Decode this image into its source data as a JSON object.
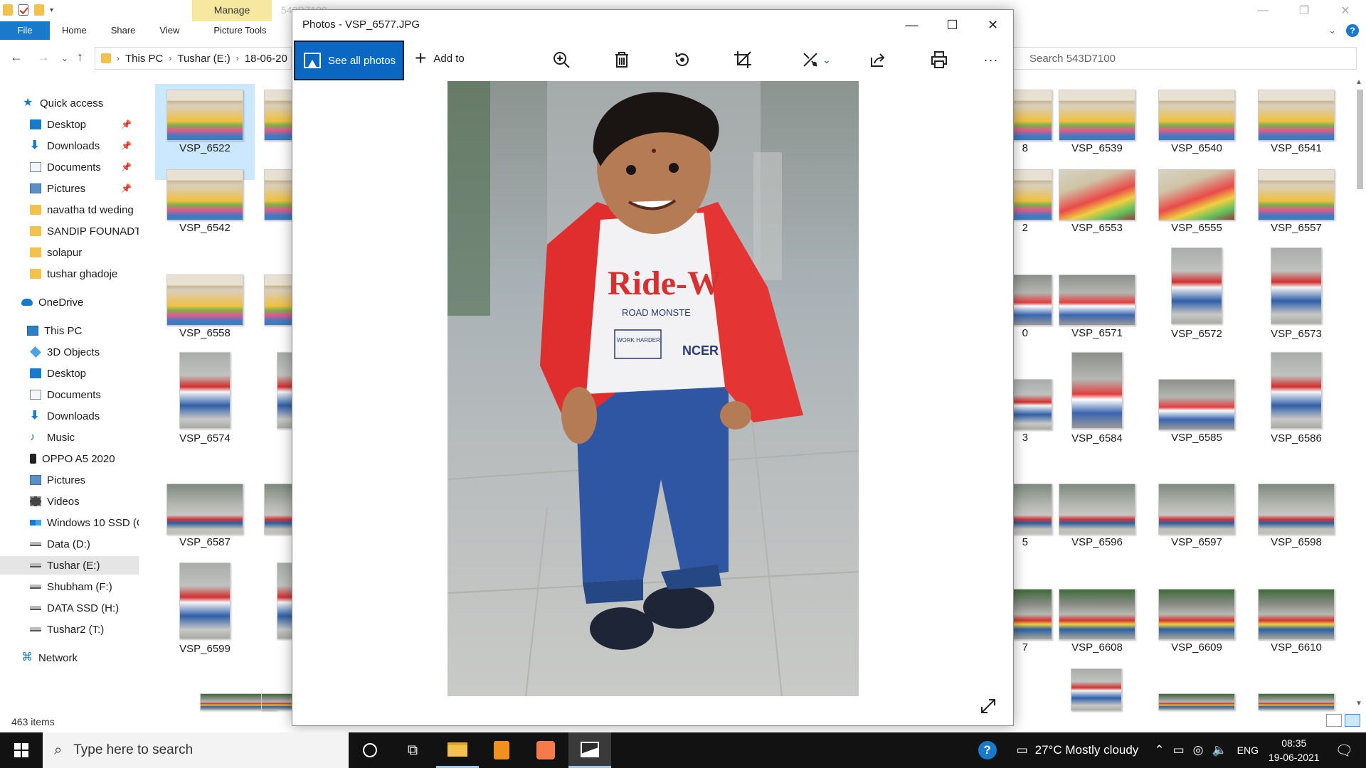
{
  "explorer": {
    "ghost_title": "543D7100",
    "manage_label": "Manage",
    "ribbon_tabs": [
      "File",
      "Home",
      "Share",
      "View",
      "Picture Tools"
    ],
    "breadcrumb": [
      "This PC",
      "Tushar (E:)",
      "18-06-20"
    ],
    "search_placeholder": "Search 543D7100",
    "status_items": "463 items",
    "nav": [
      {
        "label": "Quick access",
        "icon": "star-icon"
      },
      {
        "label": "Desktop",
        "icon": "desktop-icon",
        "pinned": true
      },
      {
        "label": "Downloads",
        "icon": "download-icon",
        "pinned": true
      },
      {
        "label": "Documents",
        "icon": "documents-icon",
        "pinned": true
      },
      {
        "label": "Pictures",
        "icon": "pictures-icon",
        "pinned": true
      },
      {
        "label": "navatha td weding",
        "icon": "folder-icon"
      },
      {
        "label": "SANDIP FOUNADTI",
        "icon": "folder-icon"
      },
      {
        "label": "solapur",
        "icon": "folder-icon"
      },
      {
        "label": "tushar ghadoje",
        "icon": "folder-icon"
      },
      {
        "label": "OneDrive",
        "icon": "onedrive-icon"
      },
      {
        "label": "This PC",
        "icon": "this-pc-icon"
      },
      {
        "label": "3D Objects",
        "icon": "3d-objects-icon"
      },
      {
        "label": "Desktop",
        "icon": "desktop-icon"
      },
      {
        "label": "Documents",
        "icon": "documents-icon"
      },
      {
        "label": "Downloads",
        "icon": "download-icon"
      },
      {
        "label": "Music",
        "icon": "music-icon"
      },
      {
        "label": "OPPO A5 2020",
        "icon": "phone-icon"
      },
      {
        "label": "Pictures",
        "icon": "pictures-icon"
      },
      {
        "label": "Videos",
        "icon": "videos-icon"
      },
      {
        "label": "Windows 10 SSD (C",
        "icon": "windows-drive-icon"
      },
      {
        "label": "Data (D:)",
        "icon": "drive-icon"
      },
      {
        "label": "Tushar (E:)",
        "icon": "drive-icon",
        "selected": true
      },
      {
        "label": "Shubham (F:)",
        "icon": "drive-icon"
      },
      {
        "label": "DATA SSD (H:)",
        "icon": "drive-icon"
      },
      {
        "label": "Tushar2 (T:)",
        "icon": "drive-icon"
      },
      {
        "label": "Network",
        "icon": "network-icon"
      }
    ],
    "left_files": [
      "VSP_6522",
      "VSP_6542",
      "VSP_6558",
      "VSP_6574",
      "VSP_6587",
      "VSP_6599"
    ],
    "left_files_col2": [
      "VS",
      "VS",
      "VS",
      "VS",
      "VS",
      "VS"
    ],
    "right_partial": [
      "8",
      "2",
      "0",
      "3",
      "5",
      "7"
    ],
    "right_files": [
      [
        "VSP_6539",
        "VSP_6540",
        "VSP_6541"
      ],
      [
        "VSP_6553",
        "VSP_6555",
        "VSP_6557"
      ],
      [
        "VSP_6571",
        "VSP_6572",
        "VSP_6573"
      ],
      [
        "VSP_6584",
        "VSP_6585",
        "VSP_6586"
      ],
      [
        "VSP_6596",
        "VSP_6597",
        "VSP_6598"
      ],
      [
        "VSP_6608",
        "VSP_6609",
        "VSP_6610"
      ]
    ]
  },
  "photos": {
    "title": "Photos - VSP_6577.JPG",
    "see_all": "See all photos",
    "add_to": "Add to",
    "shirt_text": "Ride-W",
    "shirt_sub": "ROAD MONSTE",
    "shirt_badge": "WORK HARDER",
    "shirt_side": "NCER",
    "toolbar_icons": [
      "zoom-in-icon",
      "delete-icon",
      "rotate-icon",
      "crop-icon",
      "edit-icon",
      "share-icon",
      "print-icon",
      "more-icon"
    ]
  },
  "taskbar": {
    "search_placeholder": "Type here to search",
    "weather": "27°C  Mostly cloudy",
    "language": "ENG",
    "time": "08:35",
    "date": "19-06-2021"
  },
  "colors": {
    "accent": "#1979ca",
    "photos_accent": "#0a68c3",
    "selection": "#cce8ff",
    "manage_tab": "#f7e8a0"
  }
}
